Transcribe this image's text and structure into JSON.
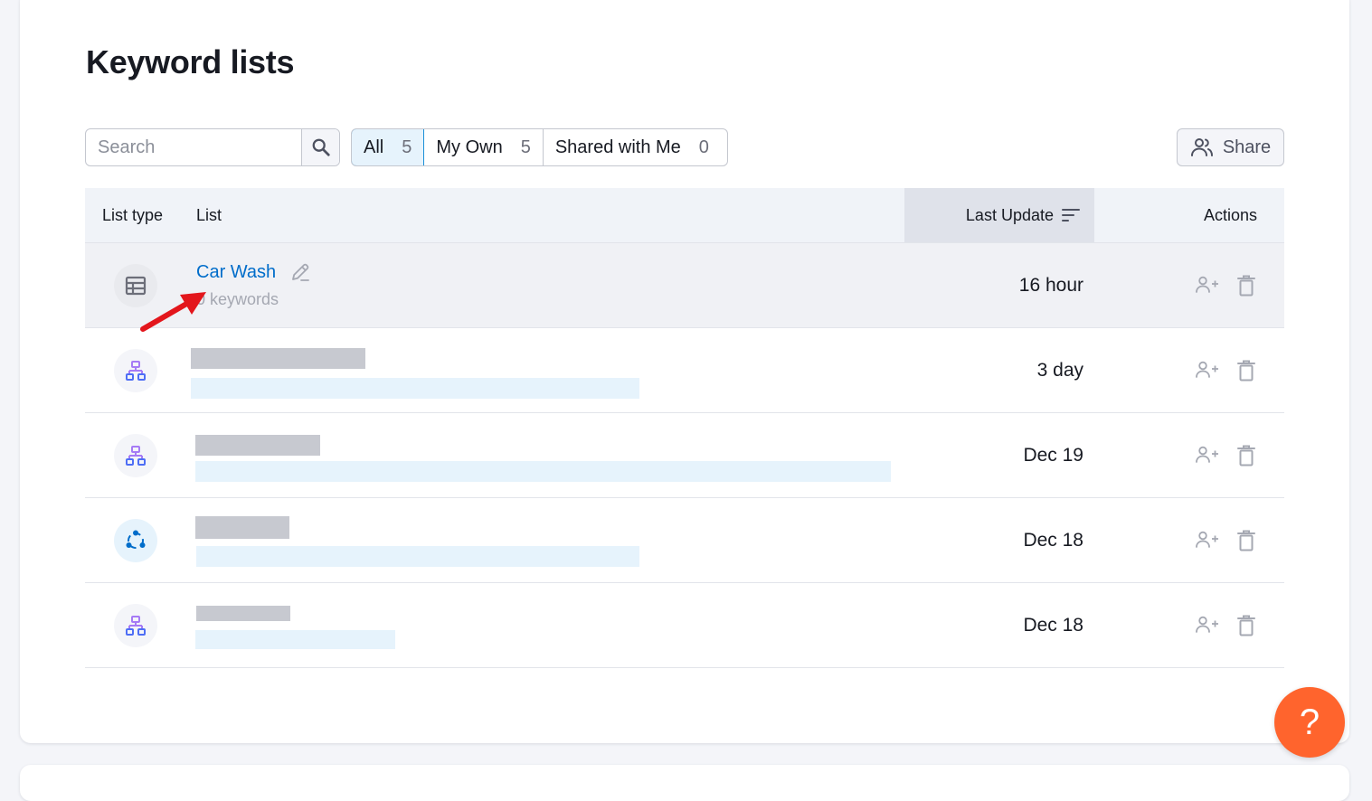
{
  "page": {
    "title": "Keyword lists"
  },
  "search": {
    "placeholder": "Search",
    "value": ""
  },
  "tabs": [
    {
      "label": "All",
      "count": "5",
      "active": true
    },
    {
      "label": "My Own",
      "count": "5",
      "active": false
    },
    {
      "label": "Shared with Me",
      "count": "0",
      "active": false
    }
  ],
  "share": {
    "label": "Share"
  },
  "table": {
    "columns": {
      "type": "List type",
      "list": "List",
      "last_update": "Last Update",
      "actions": "Actions"
    },
    "rows": [
      {
        "type_icon": "table-icon",
        "name": "Car Wash",
        "subtitle": "0 keywords",
        "last_update": "16 hour",
        "highlighted": true
      },
      {
        "type_icon": "hierarchy-icon",
        "name": "",
        "subtitle": "",
        "last_update": "3 day",
        "redacted": true
      },
      {
        "type_icon": "hierarchy-icon",
        "name": "",
        "subtitle": "",
        "last_update": "Dec 19",
        "redacted": true
      },
      {
        "type_icon": "cluster-icon",
        "name": "",
        "subtitle": "",
        "last_update": "Dec 18",
        "redacted": true
      },
      {
        "type_icon": "hierarchy-icon",
        "name": "",
        "subtitle": "",
        "last_update": "Dec 18",
        "redacted": true
      }
    ]
  },
  "help": {
    "label": "?"
  },
  "colors": {
    "accent": "#1a8fd8",
    "link": "#006dca",
    "help": "#ff642d",
    "annotation_arrow": "#e3161c"
  }
}
